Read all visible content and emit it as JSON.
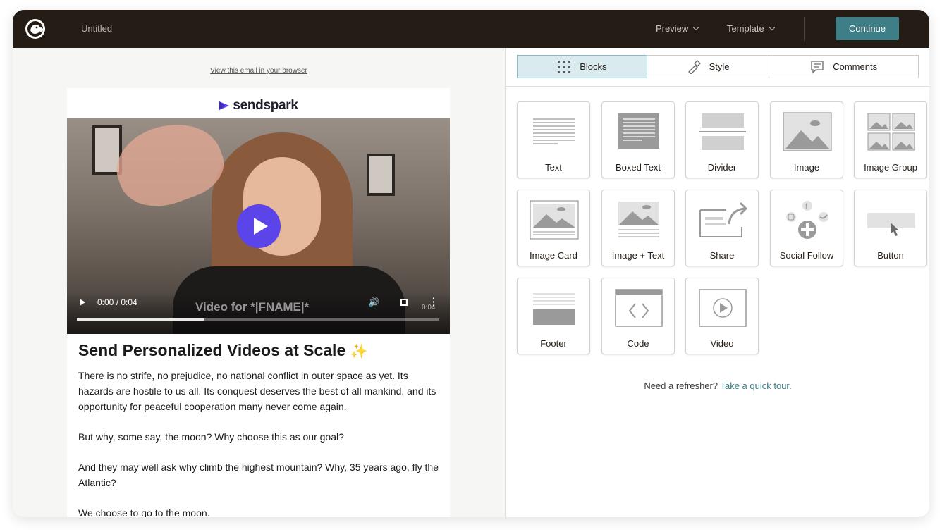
{
  "topbar": {
    "title": "Untitled",
    "preview_label": "Preview",
    "template_label": "Template",
    "continue_label": "Continue"
  },
  "email": {
    "browser_link": "View this email in your browser",
    "brand_name": "sendspark",
    "video": {
      "time": "0:00 / 0:04",
      "overlay_text": "Video for *|FNAME|*",
      "small_time": "0:04",
      "progress": 0.35
    },
    "heading": "Send Personalized Videos at Scale",
    "heading_emoji": "✨",
    "paragraphs": [
      "There is no strife, no prejudice, no national conflict in outer space as yet. Its hazards are hostile to us all. Its conquest deserves the best of all mankind, and its opportunity for peaceful cooperation many never come again.",
      "But why, some say, the moon? Why choose this as our goal?",
      "And they may well ask why climb the highest mountain? Why, 35 years ago, fly the Atlantic?",
      "We choose to go to the moon."
    ]
  },
  "panel": {
    "tabs": [
      {
        "label": "Blocks",
        "icon": "grid-icon",
        "active": true
      },
      {
        "label": "Style",
        "icon": "paint-icon",
        "active": false
      },
      {
        "label": "Comments",
        "icon": "comment-icon",
        "active": false
      }
    ],
    "blocks": [
      {
        "label": "Text",
        "icon": "text-block-icon"
      },
      {
        "label": "Boxed Text",
        "icon": "boxed-text-block-icon"
      },
      {
        "label": "Divider",
        "icon": "divider-block-icon"
      },
      {
        "label": "Image",
        "icon": "image-block-icon"
      },
      {
        "label": "Image Group",
        "icon": "image-group-block-icon"
      },
      {
        "label": "Image Card",
        "icon": "image-card-block-icon"
      },
      {
        "label": "Image + Text",
        "icon": "image-text-block-icon"
      },
      {
        "label": "Share",
        "icon": "share-block-icon"
      },
      {
        "label": "Social Follow",
        "icon": "social-follow-block-icon"
      },
      {
        "label": "Button",
        "icon": "button-block-icon"
      },
      {
        "label": "Footer",
        "icon": "footer-block-icon"
      },
      {
        "label": "Code",
        "icon": "code-block-icon"
      },
      {
        "label": "Video",
        "icon": "video-block-icon"
      }
    ],
    "refresher_text": "Need a refresher?",
    "tour_link": "Take a quick tour",
    "refresher_end": "."
  },
  "colors": {
    "topbar_bg": "#241c15",
    "accent": "#3e7e87",
    "play_button": "#5b44e8",
    "active_tab_bg": "#d9ebef"
  }
}
